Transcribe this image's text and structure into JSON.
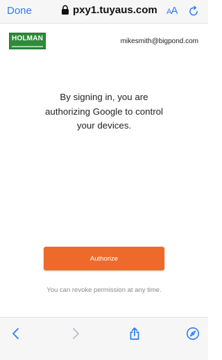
{
  "browser": {
    "done_label": "Done",
    "url": "pxy1.tuyaus.com",
    "text_size_label_small": "A",
    "text_size_label_large": "A",
    "accent_color": "#2f7cf6"
  },
  "header": {
    "logo_text": "HOLMAN",
    "email": "mikesmith@bigpond.com"
  },
  "message": {
    "lines": [
      "By signing in, you are",
      "authorizing Google to control",
      "your devices."
    ]
  },
  "actions": {
    "authorize_label": "Authorize",
    "authorize_color": "#ee6a2a",
    "revoke_note": "You can revoke permission at any time."
  },
  "toolbar": {
    "icons": [
      "back-icon",
      "forward-icon",
      "share-icon",
      "compass-icon"
    ]
  }
}
